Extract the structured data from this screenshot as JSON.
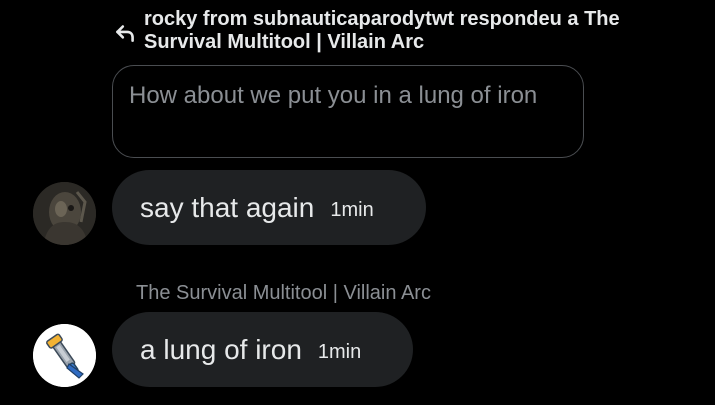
{
  "reply_header": {
    "text": "rocky from subnauticaparodytwt respondeu a The Survival Multitool | Villain Arc",
    "icon": "reply-arrow-icon"
  },
  "quoted_message": {
    "text": "How about we put you in a lung of iron"
  },
  "messages": [
    {
      "avatar_icon": "avatar-dark-photo",
      "text": "say that again",
      "time": "1min"
    },
    {
      "sender": "The Survival Multitool | Villain Arc",
      "avatar_icon": "avatar-multitool",
      "text": "a lung of iron",
      "time": "1min"
    }
  ],
  "colors": {
    "background": "#000000",
    "bubble": "#1f2123",
    "muted_text": "#8b8f94",
    "primary_text": "#e7e9ea"
  }
}
